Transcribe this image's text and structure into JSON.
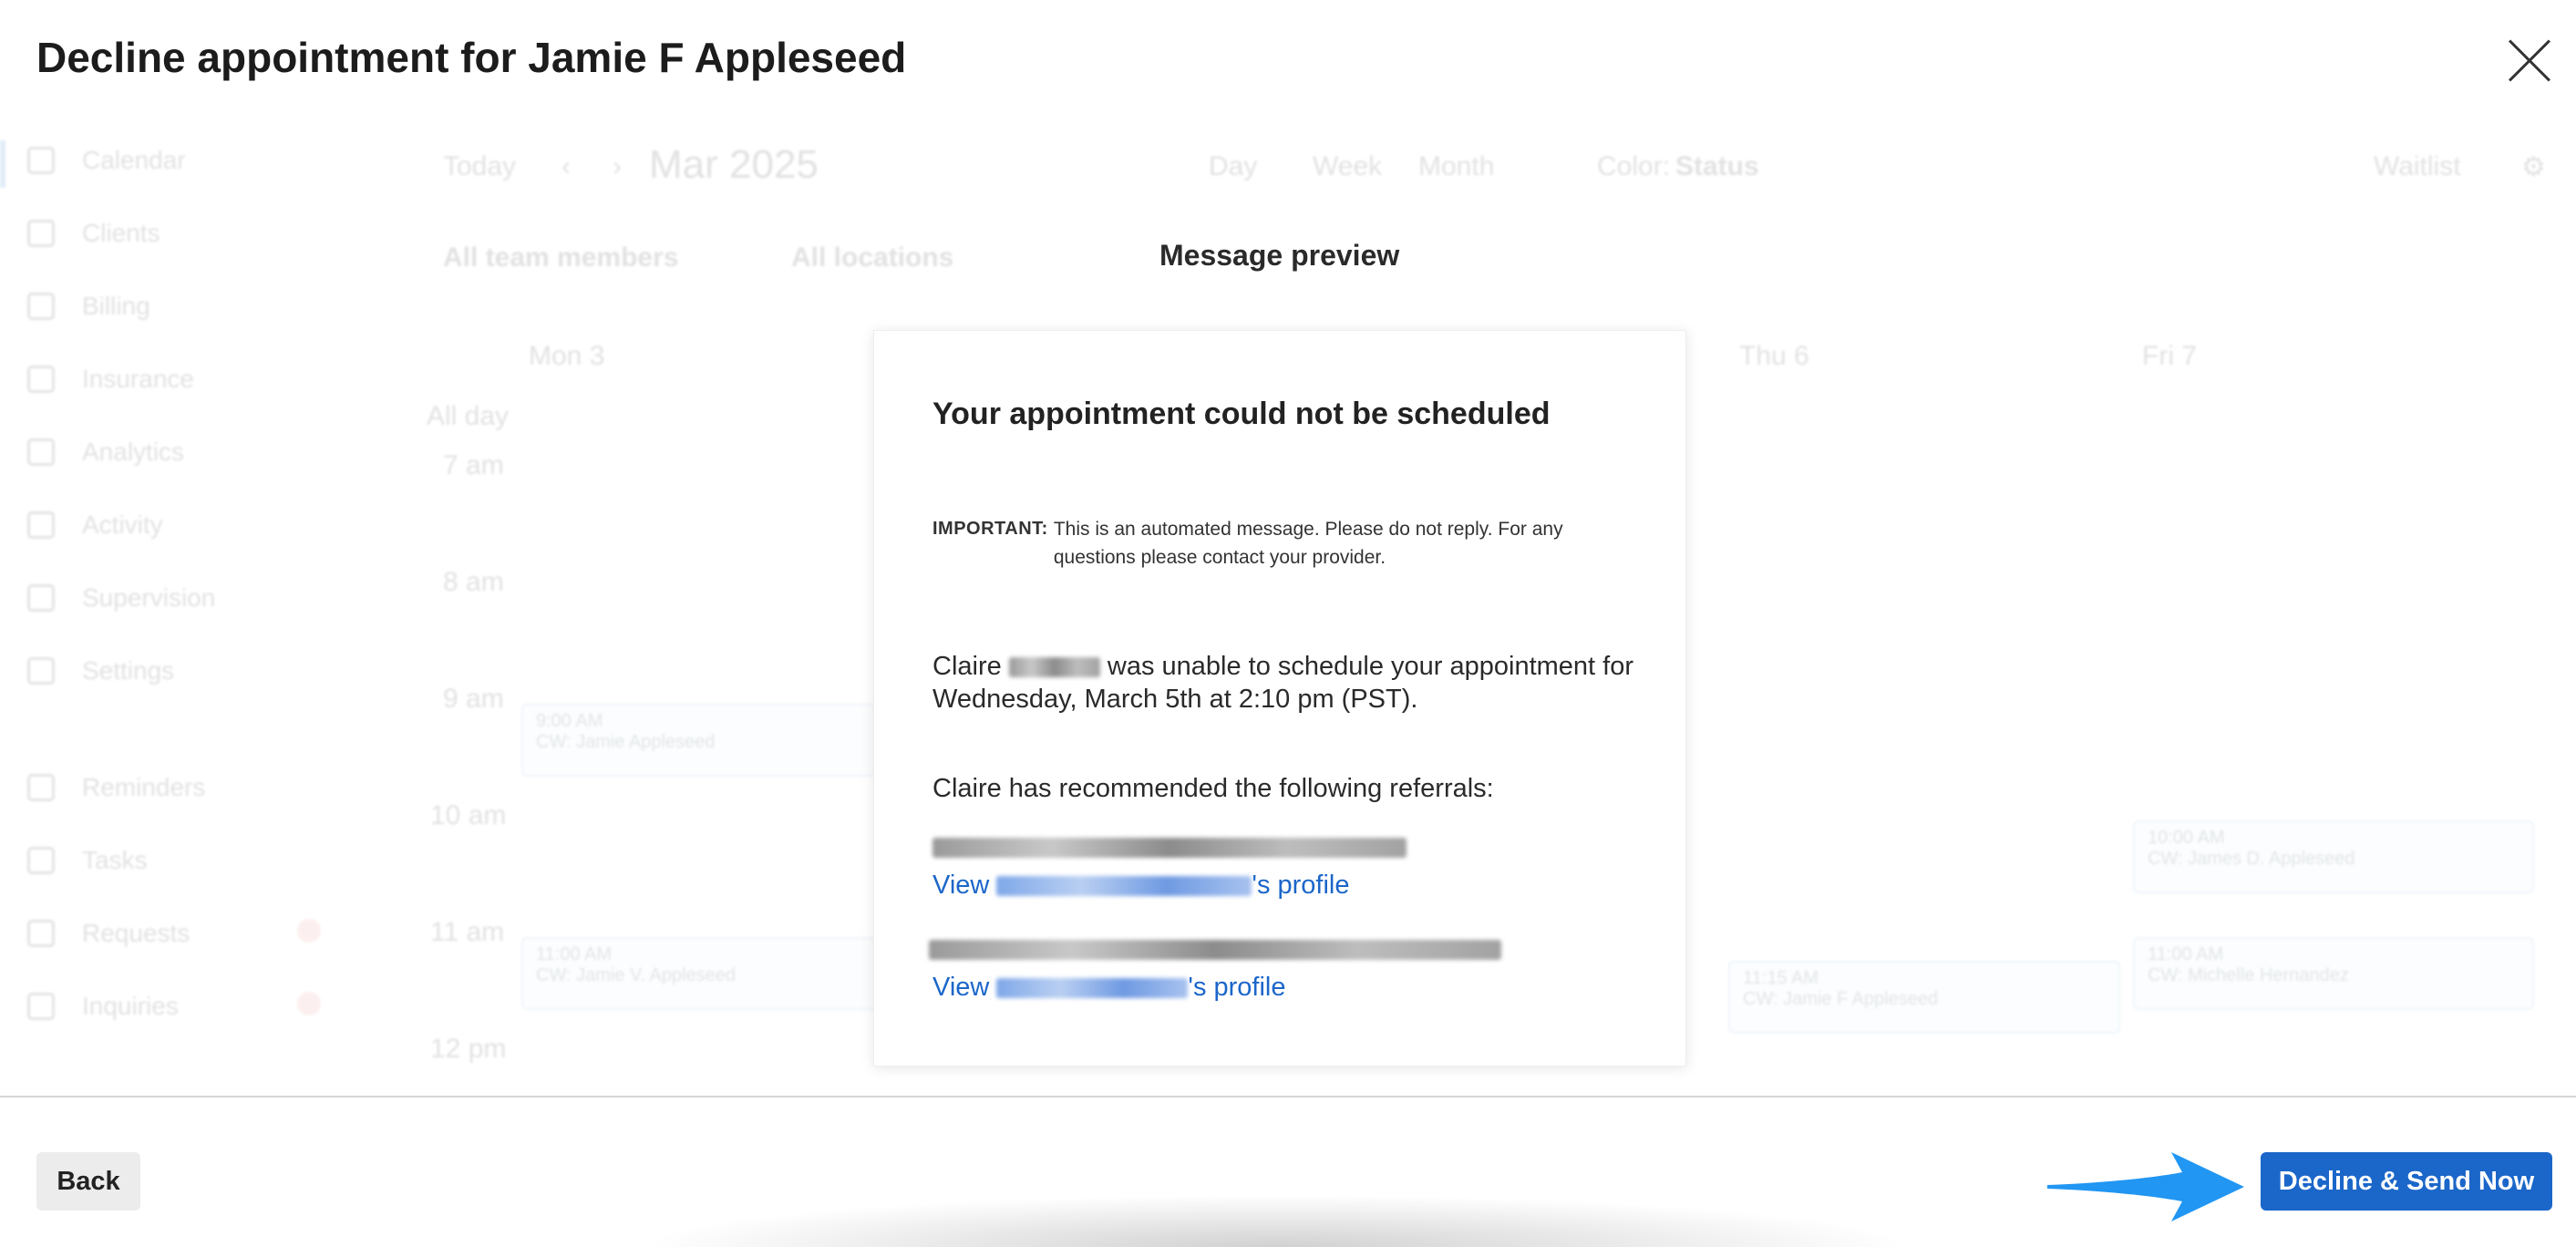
{
  "dialog": {
    "title": "Decline appointment for Jamie F Appleseed",
    "close_icon": "close-icon"
  },
  "background": {
    "sidebar": [
      "Calendar",
      "Clients",
      "Billing",
      "Insurance",
      "Analytics",
      "Activity",
      "Supervision",
      "Settings",
      "Reminders",
      "Tasks",
      "Requests",
      "Inquiries"
    ],
    "toolbar": {
      "today": "Today",
      "month": "Mar 2025",
      "views": [
        "Day",
        "Week",
        "Month"
      ],
      "color_label": "Color:",
      "color_value": "Status",
      "waitlist": "Waitlist",
      "team_filter": "All team members",
      "location_filter": "All locations"
    },
    "days": [
      "Mon 3",
      "Thu 6",
      "Fri 7"
    ],
    "times": [
      "All day",
      "7 am",
      "8 am",
      "9 am",
      "10 am",
      "11 am",
      "12 pm"
    ],
    "events": [
      {
        "time": "9:00 AM",
        "title": "CW: Jamie Appleseed"
      },
      {
        "time": "11:00 AM",
        "title": "CW: Jamie V. Appleseed"
      },
      {
        "time": "10:00 AM",
        "title": "CW: James D. Appleseed"
      },
      {
        "time": "11:00 AM",
        "title": "CW: Michelle Hernandez"
      },
      {
        "time": "11:15 AM",
        "title": "CW: Jamie F Appleseed"
      }
    ]
  },
  "preview": {
    "heading": "Message preview",
    "card_title": "Your appointment could not be scheduled",
    "important_label": "IMPORTANT:",
    "important_text": "This is an automated message. Please do not reply. For any questions please contact your provider.",
    "provider_first": "Claire",
    "unable_text": "was unable to schedule your appointment for Wednesday, March 5th at 2:10 pm (PST).",
    "referrals_intro": "Claire has recommended the following referrals:",
    "view_label": "View",
    "profile_suffix": "'s profile"
  },
  "footer": {
    "back_label": "Back",
    "send_label": "Decline & Send Now"
  },
  "colors": {
    "primary": "#1b66c9",
    "arrow": "#2196f3"
  }
}
